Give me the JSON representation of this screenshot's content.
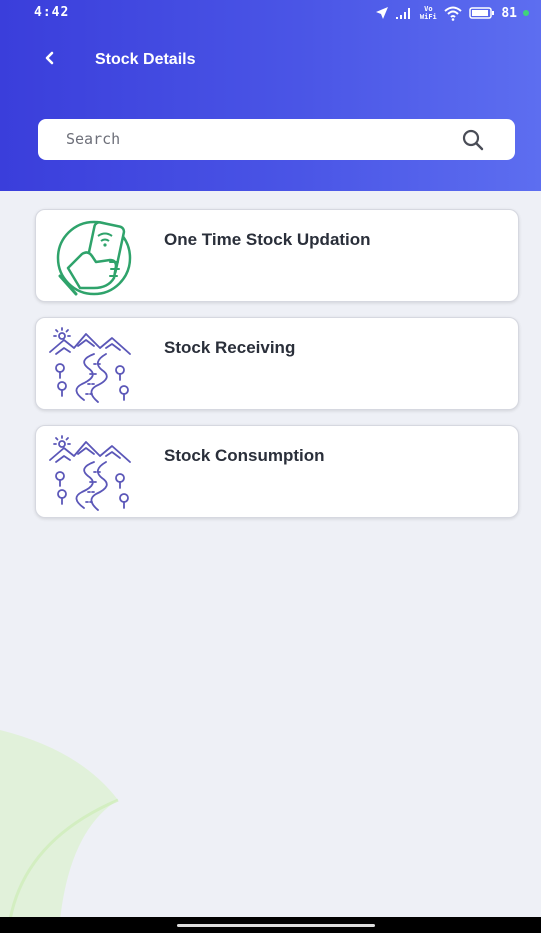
{
  "status_bar": {
    "time": "4:42",
    "network_label": "Vo WiFi",
    "battery": "81",
    "icons": [
      "location-arrow-icon",
      "signal-icon",
      "vowifi-icon",
      "wifi-icon",
      "battery-icon",
      "charging-dot-icon"
    ]
  },
  "header": {
    "back_icon": "chevron-left-icon",
    "title": "Stock Details"
  },
  "search": {
    "placeholder": "Search",
    "value": "",
    "icon": "search-icon"
  },
  "menu_items": [
    {
      "label": "One Time Stock Updation",
      "icon": "hand-phone-icon"
    },
    {
      "label": "Stock Receiving",
      "icon": "landscape-river-icon"
    },
    {
      "label": "Stock Consumption",
      "icon": "landscape-river-icon"
    }
  ],
  "colors": {
    "header_gradient_start": "#3a3edb",
    "header_gradient_end": "#5d6ef0",
    "background": "#eef0f6",
    "card": "#ffffff",
    "icon_green": "#2fa36b",
    "icon_purple": "#5b57b8",
    "text": "#2a2f3a"
  }
}
